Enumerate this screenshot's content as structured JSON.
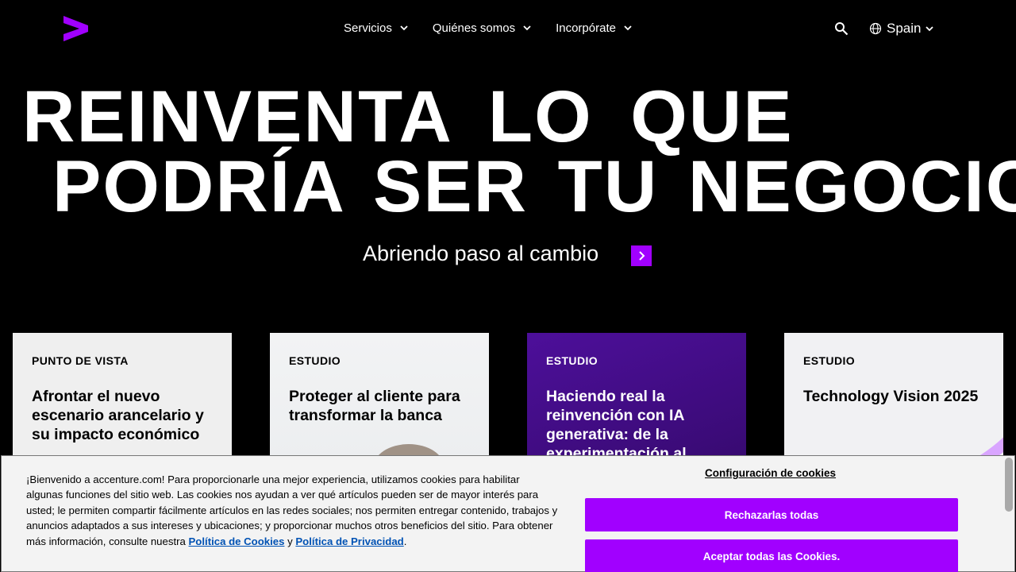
{
  "colors": {
    "accent": "#a100ff",
    "background": "#000000",
    "banner": "#f3f3f3",
    "link": "#0052b4"
  },
  "header": {
    "logo_icon": "accenture-greater-than-logo",
    "nav": [
      {
        "label": "Servicios"
      },
      {
        "label": "Quiénes somos"
      },
      {
        "label": "Incorpórate"
      }
    ],
    "search_icon": "search-icon",
    "region": {
      "label": "Spain",
      "icon": "globe-icon"
    }
  },
  "hero": {
    "line1": "REINVENTA LO QUE",
    "line2": "PODRÍA SER TU NEGOCIO",
    "subtitle": "Abriendo paso al cambio",
    "subtitle_icon": "chevron-right-icon"
  },
  "cards": [
    {
      "eyebrow": "PUNTO DE VISTA",
      "title": "Afrontar el nuevo escenario arancelario y su impacto económico"
    },
    {
      "eyebrow": "ESTUDIO",
      "title": "Proteger al cliente para transformar la banca"
    },
    {
      "eyebrow": "ESTUDIO",
      "title": "Haciendo real la reinvención con IA generativa: de la experimentación al"
    },
    {
      "eyebrow": "ESTUDIO",
      "title": "Technology Vision 2025"
    }
  ],
  "cookie_banner": {
    "text_before": "¡Bienvenido a accenture.com! Para proporcionarle una mejor experiencia, utilizamos cookies para habilitar algunas funciones del sitio web. Las cookies nos ayudan a ver qué artículos pueden ser de mayor interés para usted; le permiten compartir fácilmente artículos en las redes sociales; nos permiten entregar contenido, trabajos y anuncios adaptados a sus intereses y ubicaciones; y proporcionar muchos otros beneficios del sitio. Para obtener más información, consulte nuestra",
    "cookie_policy_link": "Política de Cookies",
    "conjunction": "y",
    "privacy_link": "Política de Privacidad",
    "period": ".",
    "settings_link": "Configuración de cookies",
    "reject_button": "Rechazarlas todas",
    "accept_button": "Aceptar todas las Cookies."
  }
}
